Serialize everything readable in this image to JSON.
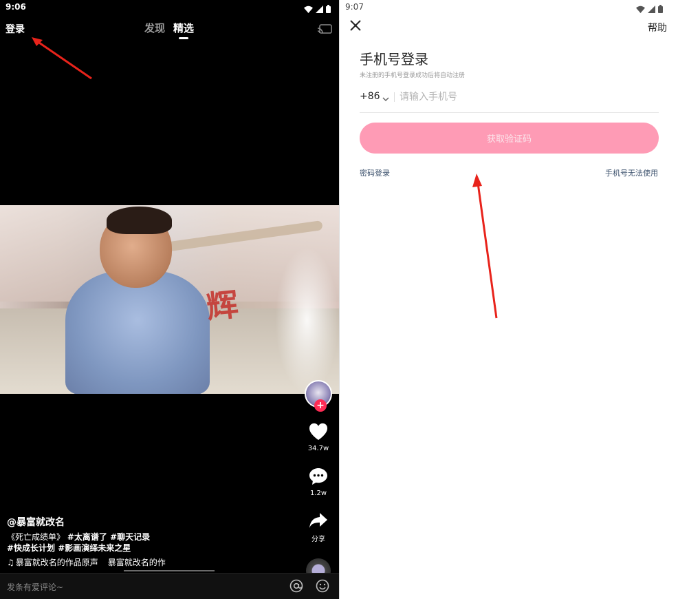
{
  "left": {
    "status": {
      "time": "9:06"
    },
    "top": {
      "login": "登录",
      "tabs": [
        {
          "label": "发现",
          "active": false
        },
        {
          "label": "精选",
          "active": true
        }
      ]
    },
    "video": {
      "sign_text": "辉"
    },
    "side": {
      "like_count": "34.7w",
      "comment_count": "1.2w",
      "share_label": "分享"
    },
    "desc": {
      "author": "@暴富就改名",
      "line1_title": "《死亡成绩单》",
      "line1_tags": "#太离谱了 #聊天记录",
      "line2_tags": "#快成长计划 #影画演绎未来之星",
      "music_a": "暴富就改名的作品原声",
      "music_b": "暴富就改名的作"
    },
    "comment": {
      "placeholder": "发条有爱评论~"
    }
  },
  "right": {
    "status": {
      "time": "9:07"
    },
    "help": "帮助",
    "title": "手机号登录",
    "hint": "未注册的手机号登录成功后将自动注册",
    "country_code": "+86",
    "phone_placeholder": "请输入手机号",
    "get_code": "获取验证码",
    "password_login": "密码登录",
    "phone_unusable": "手机号无法使用"
  },
  "colors": {
    "accent_pink": "#fe9bb5",
    "follow_red": "#fe2c55",
    "arrow_red": "#e8231b"
  }
}
